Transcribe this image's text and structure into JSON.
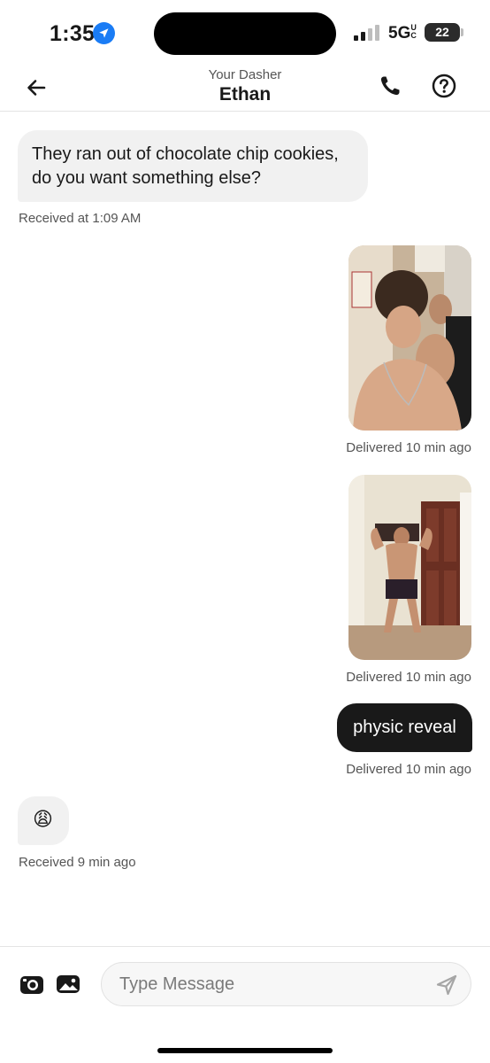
{
  "status_bar": {
    "time": "1:35",
    "network": "5G",
    "network_sup": "UC",
    "battery": "22",
    "icons": [
      "location-arrow-icon",
      "signal-icon"
    ]
  },
  "header": {
    "subtitle": "Your Dasher",
    "title": "Ethan",
    "icons": [
      "back-arrow-icon",
      "phone-icon",
      "help-icon"
    ]
  },
  "messages": [
    {
      "direction": "incoming",
      "type": "text",
      "text": "They ran out of chocolate chip cookies, do you want something else?",
      "meta": "Received at 1:09 AM"
    },
    {
      "direction": "outgoing",
      "type": "photo",
      "meta": "Delivered 10 min ago"
    },
    {
      "direction": "outgoing",
      "type": "photo",
      "meta": "Delivered 10 min ago"
    },
    {
      "direction": "outgoing",
      "type": "text",
      "text": "physic reveal",
      "meta": "Delivered 10 min ago"
    },
    {
      "direction": "incoming",
      "type": "emoji",
      "text": "😩",
      "meta": "Received 9 min ago"
    }
  ],
  "composer": {
    "placeholder": "Type Message",
    "icons": [
      "camera-icon",
      "gallery-icon",
      "send-icon"
    ]
  },
  "colors": {
    "incoming_bubble": "#f1f1f1",
    "outgoing_bubble": "#191919",
    "meta_text": "#555555",
    "location_blue": "#1a7cf5"
  }
}
